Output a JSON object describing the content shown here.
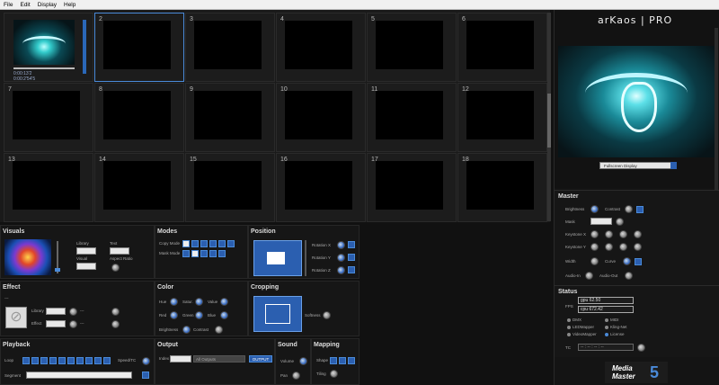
{
  "menu": [
    "File",
    "Edit",
    "Display",
    "Help"
  ],
  "grid": {
    "cells": [
      "",
      "2",
      "3",
      "4",
      "5",
      "6",
      "7",
      "8",
      "9",
      "10",
      "11",
      "12",
      "13",
      "14",
      "15",
      "16",
      "17",
      "18"
    ],
    "active_index": 1,
    "clip1": {
      "time1": "0:00:13'2",
      "time2": "0:00:2'54'5"
    }
  },
  "visuals": {
    "title": "Visuals",
    "library": "Library",
    "text": "Text",
    "visual": "Visual",
    "aspect_ratio": "Aspect Ratio"
  },
  "modes": {
    "title": "Modes",
    "copy_mode": "Copy Mode",
    "mask_mode": "Mask Mode"
  },
  "position": {
    "title": "Position",
    "rot_x": "Rotation X",
    "rot_y": "Rotation Y",
    "rot_z": "Rotation Z"
  },
  "effect": {
    "title": "Effect",
    "library": "Library",
    "effect": "Effect",
    "dash": "---"
  },
  "color": {
    "title": "Color",
    "hue": "Hue",
    "satur": "Satur.",
    "value": "Value",
    "red": "Red",
    "green": "Green",
    "blue": "Blue",
    "brightness": "Brightness",
    "contrast": "Contrast"
  },
  "cropping": {
    "title": "Cropping",
    "softness": "Softness"
  },
  "playback": {
    "title": "Playback",
    "loop": "Loop",
    "speed": "Speed/TC",
    "segment": "Segment"
  },
  "output": {
    "title": "Output",
    "index": "Index",
    "value": "All Outputs",
    "button": "OUTPUT"
  },
  "sound": {
    "title": "Sound",
    "volume": "Volume",
    "pan": "Pan"
  },
  "mapping": {
    "title": "Mapping",
    "shape": "Shape",
    "tiling": "Tiling"
  },
  "right": {
    "logo": "arKaos | PRO",
    "display_select": "Fullscreen Display",
    "master": {
      "title": "Master",
      "brightness": "Brightness",
      "contrast": "Contrast",
      "mask": "Mask",
      "keystone_x": "Keystone X",
      "keystone_y": "Keystone Y",
      "width": "Width",
      "curve": "Curve",
      "audio_in": "Audio-In",
      "audio_out": "Audio-Out"
    },
    "status": {
      "title": "Status",
      "fps": "FPS",
      "gpu": "gpu 62.50",
      "cpu": "cpu 672.42",
      "dmx": "DMX",
      "midi": "MIDI",
      "ledmapper": "LEDMapper",
      "kling_net": "Kling-Net",
      "videomapper": "VideoMapper",
      "license": "License",
      "tc": "TC",
      "tc_value": "-- : -- : -- : --"
    },
    "brand": {
      "line1": "Media",
      "line2": "Master",
      "num": "5",
      "suffix": "pro"
    }
  }
}
